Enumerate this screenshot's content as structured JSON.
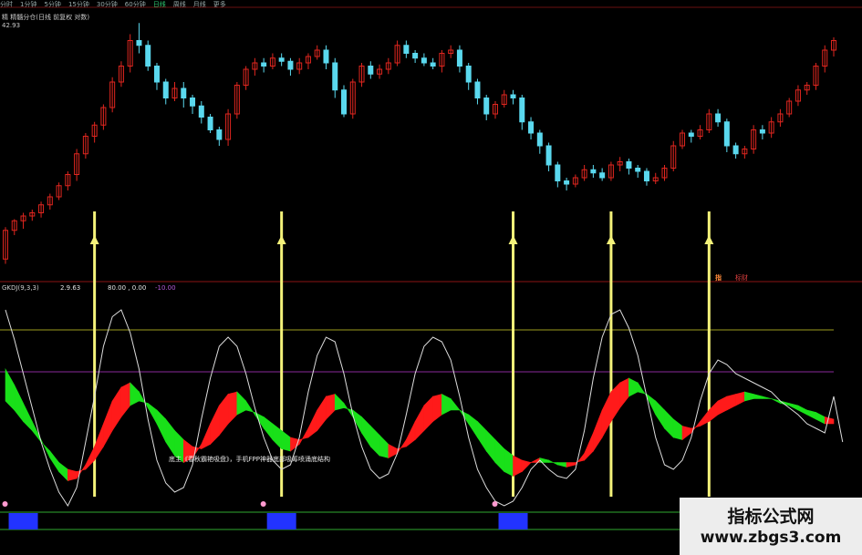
{
  "toolbar": {
    "tabs": [
      "分时",
      "1分钟",
      "5分钟",
      "15分钟",
      "30分钟",
      "60分钟",
      "日线",
      "周线",
      "月线",
      "更多"
    ],
    "active_index": 6
  },
  "main_chart": {
    "indicator_label": "精 精髓分仓(日线 前复权 对数)",
    "price_readout": "42.93"
  },
  "sub_chart": {
    "indicator_label": "GKDJ(9,3,3)",
    "value_readout": "2.9.63",
    "band_readout": "80.00 , 0.00",
    "band_extra": "-10.00",
    "tag_1": "指",
    "tag_2": "标财",
    "annotation": "底主《春秋霸艳吸盘》，手机FPP神器底部吸筹喷涌底结构"
  },
  "watermark": {
    "title": "指标公式网",
    "url": "www.zbgs3.com"
  },
  "colors": {
    "up": "#e0261f",
    "down": "#5ad8ee",
    "kdj_up": "#ff1a1a",
    "kdj_down": "#19e019",
    "signal": "#f4f27a",
    "grid_green": "#2faa2f",
    "grid_olive": "#9c9c1e",
    "grid_purple": "#8a2a9a",
    "blue_bar": "#2233ff"
  },
  "chart_data": {
    "type": "candlestick+kdj",
    "candles": [
      [
        49,
        67,
        46,
        69
      ],
      [
        67,
        73,
        64,
        74
      ],
      [
        73,
        76,
        68,
        78
      ],
      [
        76,
        78,
        73,
        80
      ],
      [
        78,
        83,
        75,
        85
      ],
      [
        83,
        88,
        80,
        90
      ],
      [
        88,
        95,
        86,
        97
      ],
      [
        95,
        102,
        92,
        104
      ],
      [
        102,
        115,
        98,
        118
      ],
      [
        115,
        126,
        112,
        128
      ],
      [
        126,
        133,
        122,
        135
      ],
      [
        133,
        144,
        130,
        146
      ],
      [
        144,
        160,
        141,
        163
      ],
      [
        160,
        170,
        157,
        173
      ],
      [
        170,
        186,
        166,
        190
      ],
      [
        186,
        183,
        178,
        197
      ],
      [
        183,
        170,
        167,
        186
      ],
      [
        170,
        160,
        155,
        172
      ],
      [
        160,
        150,
        146,
        162
      ],
      [
        150,
        156,
        148,
        160
      ],
      [
        156,
        150,
        144,
        160
      ],
      [
        150,
        145,
        140,
        152
      ],
      [
        145,
        138,
        134,
        148
      ],
      [
        138,
        130,
        128,
        140
      ],
      [
        130,
        124,
        120,
        132
      ],
      [
        124,
        140,
        120,
        143
      ],
      [
        140,
        158,
        137,
        160
      ],
      [
        158,
        168,
        155,
        170
      ],
      [
        168,
        172,
        164,
        175
      ],
      [
        172,
        170,
        166,
        175
      ],
      [
        170,
        175,
        168,
        178
      ],
      [
        175,
        173,
        170,
        178
      ],
      [
        173,
        168,
        164,
        175
      ],
      [
        168,
        172,
        165,
        175
      ],
      [
        172,
        176,
        168,
        178
      ],
      [
        176,
        180,
        174,
        183
      ],
      [
        180,
        172,
        168,
        183
      ],
      [
        172,
        155,
        150,
        175
      ],
      [
        155,
        140,
        138,
        158
      ],
      [
        140,
        160,
        137,
        162
      ],
      [
        160,
        170,
        157,
        172
      ],
      [
        170,
        165,
        162,
        173
      ],
      [
        165,
        168,
        162,
        171
      ],
      [
        168,
        172,
        165,
        175
      ],
      [
        172,
        183,
        170,
        186
      ],
      [
        183,
        178,
        175,
        186
      ],
      [
        178,
        175,
        172,
        180
      ],
      [
        175,
        172,
        170,
        178
      ],
      [
        172,
        170,
        168,
        175
      ],
      [
        170,
        178,
        166,
        180
      ],
      [
        178,
        180,
        175,
        183
      ],
      [
        180,
        170,
        166,
        183
      ],
      [
        170,
        160,
        155,
        172
      ],
      [
        160,
        150,
        146,
        162
      ],
      [
        150,
        140,
        136,
        152
      ],
      [
        140,
        146,
        137,
        148
      ],
      [
        146,
        152,
        144,
        155
      ],
      [
        152,
        150,
        146,
        155
      ],
      [
        150,
        135,
        130,
        152
      ],
      [
        135,
        128,
        124,
        138
      ],
      [
        128,
        120,
        115,
        130
      ],
      [
        120,
        108,
        104,
        122
      ],
      [
        108,
        98,
        94,
        110
      ],
      [
        98,
        96,
        92,
        100
      ],
      [
        96,
        100,
        94,
        102
      ],
      [
        100,
        105,
        98,
        108
      ],
      [
        105,
        103,
        100,
        108
      ],
      [
        103,
        100,
        98,
        106
      ],
      [
        100,
        108,
        98,
        110
      ],
      [
        108,
        110,
        104,
        113
      ],
      [
        110,
        106,
        102,
        112
      ],
      [
        106,
        104,
        100,
        108
      ],
      [
        104,
        98,
        95,
        106
      ],
      [
        98,
        100,
        96,
        103
      ],
      [
        100,
        106,
        98,
        108
      ],
      [
        106,
        120,
        104,
        123
      ],
      [
        120,
        128,
        118,
        130
      ],
      [
        128,
        126,
        122,
        130
      ],
      [
        126,
        130,
        124,
        133
      ],
      [
        130,
        140,
        128,
        143
      ],
      [
        140,
        135,
        132,
        143
      ],
      [
        135,
        120,
        116,
        137
      ],
      [
        120,
        115,
        112,
        122
      ],
      [
        115,
        118,
        112,
        120
      ],
      [
        118,
        130,
        115,
        133
      ],
      [
        130,
        128,
        124,
        133
      ],
      [
        128,
        135,
        125,
        138
      ],
      [
        135,
        140,
        132,
        143
      ],
      [
        140,
        148,
        138,
        150
      ],
      [
        148,
        155,
        145,
        158
      ],
      [
        155,
        158,
        152,
        160
      ],
      [
        158,
        170,
        155,
        172
      ],
      [
        170,
        180,
        166,
        183
      ],
      [
        180,
        186,
        176,
        188
      ]
    ],
    "kdj": {
      "k": [
        72,
        65,
        57,
        49,
        41,
        33,
        27,
        23,
        24,
        30,
        38,
        48,
        58,
        64,
        66,
        62,
        55,
        48,
        40,
        34,
        31,
        33,
        39,
        48,
        56,
        61,
        62,
        58,
        52,
        46,
        41,
        37,
        36,
        39,
        46,
        54,
        60,
        61,
        57,
        51,
        44,
        38,
        34,
        33,
        35,
        41,
        49,
        56,
        60,
        61,
        59,
        54,
        48,
        42,
        36,
        31,
        27,
        25,
        27,
        31,
        33,
        32,
        30,
        29,
        30,
        35,
        44,
        54,
        62,
        66,
        68,
        66,
        60,
        52,
        46,
        42,
        41,
        44,
        49,
        54,
        58,
        60,
        61,
        62,
        61,
        60,
        59,
        57,
        56,
        54,
        52,
        50,
        48,
        48,
        45
      ],
      "d": [
        58,
        54,
        49,
        45,
        40,
        36,
        31,
        28,
        27,
        28,
        32,
        38,
        45,
        51,
        56,
        58,
        57,
        54,
        50,
        45,
        41,
        38,
        37,
        39,
        43,
        48,
        52,
        54,
        53,
        51,
        48,
        45,
        42,
        41,
        42,
        45,
        50,
        54,
        55,
        54,
        51,
        47,
        43,
        39,
        37,
        38,
        41,
        45,
        49,
        52,
        54,
        54,
        52,
        49,
        45,
        41,
        37,
        34,
        32,
        31,
        31,
        31,
        31,
        31,
        31,
        32,
        36,
        42,
        49,
        55,
        60,
        62,
        61,
        58,
        54,
        50,
        47,
        46,
        47,
        49,
        52,
        54,
        56,
        58,
        59,
        59,
        59,
        58,
        57,
        56,
        54,
        53,
        51,
        50,
        48
      ],
      "j": [
        98,
        85,
        70,
        55,
        40,
        28,
        18,
        12,
        20,
        40,
        60,
        82,
        95,
        98,
        88,
        72,
        50,
        32,
        22,
        18,
        20,
        30,
        50,
        68,
        82,
        86,
        82,
        70,
        55,
        42,
        32,
        28,
        30,
        42,
        62,
        78,
        86,
        84,
        70,
        52,
        38,
        28,
        24,
        26,
        35,
        52,
        70,
        82,
        86,
        84,
        76,
        60,
        42,
        28,
        20,
        14,
        12,
        14,
        20,
        28,
        32,
        28,
        25,
        24,
        28,
        45,
        68,
        86,
        96,
        98,
        90,
        78,
        60,
        42,
        30,
        28,
        32,
        42,
        58,
        70,
        76,
        74,
        70,
        68,
        66,
        64,
        62,
        58,
        55,
        52,
        48,
        46,
        44,
        60,
        40
      ]
    },
    "main_ylim": [
      40,
      200
    ],
    "sub_ylim": [
      0,
      100
    ],
    "signal_indices": [
      10,
      31,
      57,
      68,
      79
    ],
    "bottom_markers": [
      2,
      31,
      57,
      79
    ],
    "grid": "none",
    "legend": "none"
  }
}
